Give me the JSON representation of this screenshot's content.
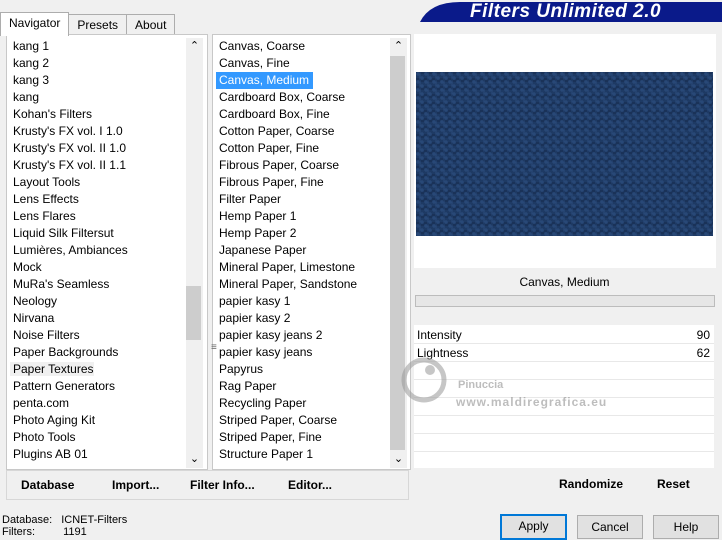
{
  "tabs": [
    "Navigator",
    "Presets",
    "About"
  ],
  "banner_title": "Filters Unlimited 2.0",
  "categories": [
    "kang 1",
    "kang 2",
    "kang 3",
    "kang",
    "Kohan's Filters",
    "Krusty's FX vol. I 1.0",
    "Krusty's FX vol. II 1.0",
    "Krusty's FX vol. II 1.1",
    "Layout Tools",
    "Lens Effects",
    "Lens Flares",
    "Liquid Silk Filtersut",
    "Lumières, Ambiances",
    "Mock",
    "MuRa's Seamless",
    "Neology",
    "Nirvana",
    "Noise Filters",
    "Paper Backgrounds",
    "Paper Textures",
    "Pattern Generators",
    "penta.com",
    "Photo Aging Kit",
    "Photo Tools",
    "Plugins AB 01"
  ],
  "selected_category": "Paper Textures",
  "filters": [
    "Canvas, Coarse",
    "Canvas, Fine",
    "Canvas, Medium",
    "Cardboard Box, Coarse",
    "Cardboard Box, Fine",
    "Cotton Paper, Coarse",
    "Cotton Paper, Fine",
    "Fibrous Paper, Coarse",
    "Fibrous Paper, Fine",
    "Filter Paper",
    "Hemp Paper 1",
    "Hemp Paper 2",
    "Japanese Paper",
    "Mineral Paper, Limestone",
    "Mineral Paper, Sandstone",
    "papier kasy 1",
    "papier kasy 2",
    "papier kasy jeans 2",
    "papier kasy jeans",
    "Papyrus",
    "Rag Paper",
    "Recycling Paper",
    "Striped Paper, Coarse",
    "Striped Paper, Fine",
    "Structure Paper 1"
  ],
  "selected_filter": "Canvas, Medium",
  "toolbar": {
    "database": "Database",
    "import": "Import...",
    "filter_info": "Filter Info...",
    "editor": "Editor..."
  },
  "filter_name": "Canvas, Medium",
  "params": [
    {
      "label": "Intensity",
      "value": "90"
    },
    {
      "label": "Lightness",
      "value": "62"
    }
  ],
  "right_toolbar": {
    "randomize": "Randomize",
    "reset": "Reset"
  },
  "status": {
    "database_label": "Database:",
    "database_value": "ICNET-Filters",
    "filters_label": "Filters:",
    "filters_value": "1191"
  },
  "buttons": {
    "apply": "Apply",
    "cancel": "Cancel",
    "help": "Help"
  },
  "watermark": {
    "name": "Pinuccia",
    "url": "www.maldiregrafica.eu"
  },
  "colors": {
    "preview": "#1e3a64",
    "selection": "#3399ff",
    "banner": "#0a1a8a"
  }
}
